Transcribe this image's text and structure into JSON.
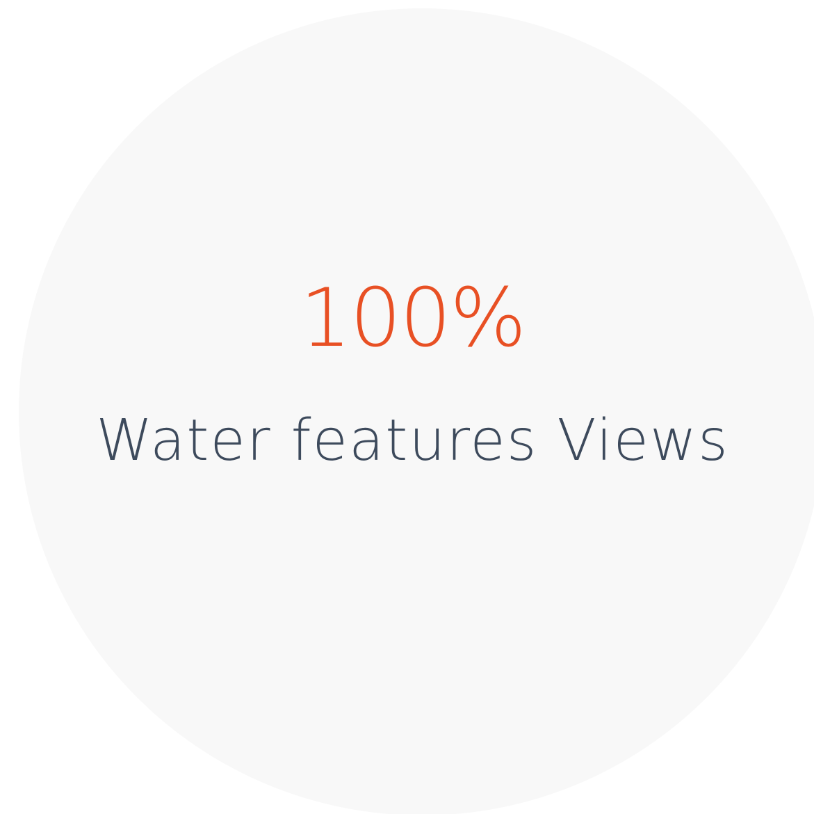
{
  "stat": {
    "value": "100%",
    "label": "Water features Views"
  },
  "colors": {
    "background": "#ffffff",
    "circle": "#f8f8f8",
    "value": "#e85024",
    "label": "#3d4a5c"
  }
}
